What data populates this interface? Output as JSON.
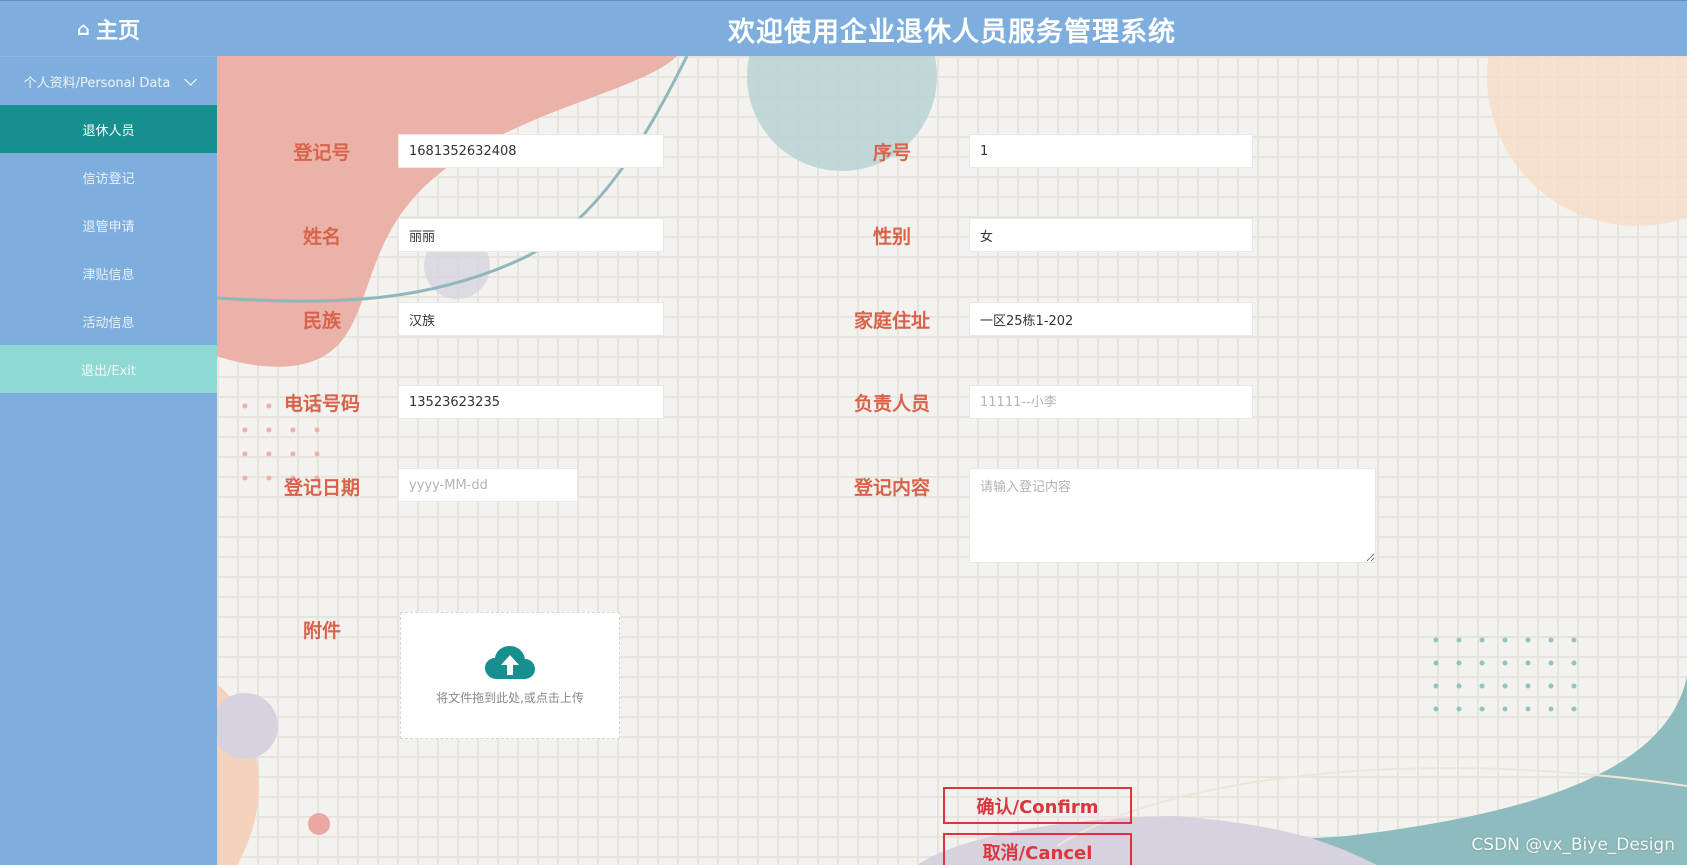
{
  "header": {
    "home_label": "主页",
    "title": "欢迎使用企业退休人员服务管理系统"
  },
  "sidebar": {
    "group_label": "个人资料/Personal Data",
    "items": [
      {
        "label": "退休人员",
        "active": true
      },
      {
        "label": "信访登记"
      },
      {
        "label": "退管申请"
      },
      {
        "label": "津贴信息"
      },
      {
        "label": "活动信息"
      },
      {
        "label": "退出/Exit"
      }
    ]
  },
  "form": {
    "register_no": {
      "label": "登记号",
      "value": "1681352632408"
    },
    "serial_no": {
      "label": "序号",
      "value": "1"
    },
    "name": {
      "label": "姓名",
      "value": "丽丽"
    },
    "gender": {
      "label": "性别",
      "value": "女"
    },
    "ethnicity": {
      "label": "民族",
      "value": "汉族"
    },
    "address": {
      "label": "家庭住址",
      "value": "一区25栋1-202"
    },
    "phone": {
      "label": "电话号码",
      "value": "13523623235"
    },
    "person_in_charge": {
      "label": "负责人员",
      "placeholder": "11111--小李"
    },
    "register_date": {
      "label": "登记日期",
      "placeholder": "yyyy-MM-dd"
    },
    "register_content": {
      "label": "登记内容",
      "placeholder": "请输入登记内容"
    },
    "attachment": {
      "label": "附件",
      "upload_hint": "将文件拖到此处,或点击上传"
    }
  },
  "actions": {
    "confirm_label": "确认/Confirm",
    "cancel_label": "取消/Cancel"
  },
  "watermark": "CSDN @vx_Biye_Design",
  "colors": {
    "sidebar": "#7eaedd",
    "active_item": "#188f8f",
    "exit_item": "#8ed9d2",
    "label": "#d9634a",
    "button": "#d9363e"
  }
}
